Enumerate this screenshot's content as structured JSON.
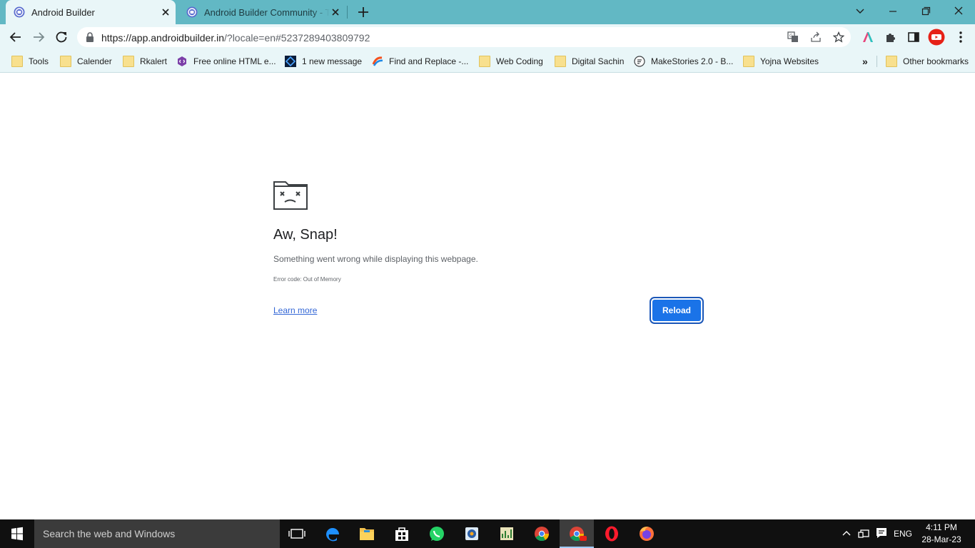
{
  "browser": {
    "tabs": [
      {
        "title": "Android Builder",
        "active": true
      },
      {
        "title": "Android Builder Community - The",
        "active": false
      }
    ],
    "url": {
      "host": "https://app.androidbuilder.in",
      "rest": "/?locale=en#5237289403809792"
    },
    "bookmarks": [
      {
        "label": "Tools",
        "icon": "folder-icon"
      },
      {
        "label": "Calender",
        "icon": "folder-icon"
      },
      {
        "label": "Rkalert",
        "icon": "folder-icon"
      },
      {
        "label": "Free online HTML e...",
        "icon": "html-editor-icon"
      },
      {
        "label": "1 new message",
        "icon": "message-icon"
      },
      {
        "label": "Find and Replace -...",
        "icon": "find-replace-icon"
      },
      {
        "label": "Web Coding",
        "icon": "folder-icon"
      },
      {
        "label": "Digital Sachin",
        "icon": "folder-icon"
      },
      {
        "label": "MakeStories 2.0 - B...",
        "icon": "makestories-icon"
      },
      {
        "label": "Yojna Websites",
        "icon": "folder-icon"
      }
    ],
    "other_bookmarks": "Other bookmarks",
    "overflow": "»"
  },
  "error_page": {
    "title": "Aw, Snap!",
    "message": "Something went wrong while displaying this webpage.",
    "error_code": "Error code: Out of Memory",
    "learn_more": "Learn more",
    "reload": "Reload"
  },
  "taskbar": {
    "search_placeholder": "Search the web and Windows",
    "language": "ENG",
    "time": "4:11 PM",
    "date": "28-Mar-23"
  },
  "colors": {
    "tab_strip": "#62b8c4",
    "toolbar": "#e9f6f8",
    "reload_button": "#1a73e8",
    "link": "#3367d6",
    "taskbar": "#101010"
  }
}
